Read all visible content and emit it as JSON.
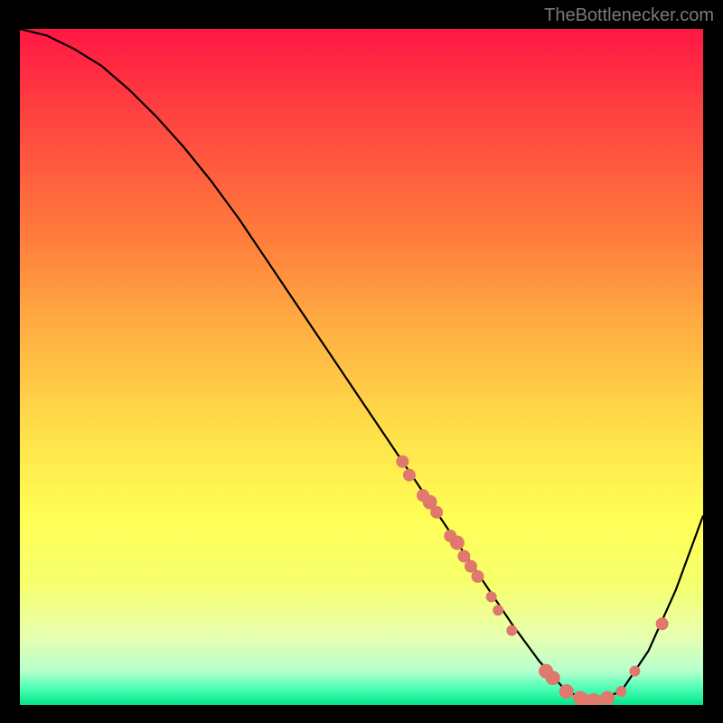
{
  "attribution": "TheBottlenecker.com",
  "chart_data": {
    "type": "line",
    "title": "",
    "xlabel": "",
    "ylabel": "",
    "xlim": [
      0,
      100
    ],
    "ylim": [
      0,
      100
    ],
    "series": [
      {
        "name": "bottleneck-curve",
        "x": [
          0,
          4,
          8,
          12,
          16,
          20,
          24,
          28,
          32,
          36,
          40,
          44,
          48,
          52,
          56,
          60,
          64,
          68,
          72,
          76,
          80,
          84,
          88,
          92,
          96,
          100
        ],
        "y": [
          100,
          99,
          97,
          94.5,
          91,
          87,
          82.5,
          77.5,
          72,
          66,
          60,
          54,
          48,
          42,
          36,
          30,
          24,
          18,
          12,
          6.5,
          2,
          0.5,
          2,
          8,
          17,
          28
        ],
        "stroke": "#000000"
      }
    ],
    "markers": [
      {
        "x": 56,
        "y": 36,
        "r": 7
      },
      {
        "x": 57,
        "y": 34,
        "r": 7
      },
      {
        "x": 59,
        "y": 31,
        "r": 7
      },
      {
        "x": 60,
        "y": 30,
        "r": 8
      },
      {
        "x": 61,
        "y": 28.5,
        "r": 7
      },
      {
        "x": 63,
        "y": 25,
        "r": 7
      },
      {
        "x": 64,
        "y": 24,
        "r": 8
      },
      {
        "x": 65,
        "y": 22,
        "r": 7
      },
      {
        "x": 66,
        "y": 20.5,
        "r": 7
      },
      {
        "x": 67,
        "y": 19,
        "r": 7
      },
      {
        "x": 69,
        "y": 16,
        "r": 6
      },
      {
        "x": 70,
        "y": 14,
        "r": 6
      },
      {
        "x": 72,
        "y": 11,
        "r": 6
      },
      {
        "x": 77,
        "y": 5,
        "r": 8
      },
      {
        "x": 78,
        "y": 4,
        "r": 8
      },
      {
        "x": 80,
        "y": 2,
        "r": 8
      },
      {
        "x": 82,
        "y": 1,
        "r": 8
      },
      {
        "x": 83,
        "y": 0.5,
        "r": 8
      },
      {
        "x": 84,
        "y": 0.5,
        "r": 9
      },
      {
        "x": 86,
        "y": 1,
        "r": 8
      },
      {
        "x": 88,
        "y": 2,
        "r": 6
      },
      {
        "x": 90,
        "y": 5,
        "r": 6
      },
      {
        "x": 94,
        "y": 12,
        "r": 7
      }
    ],
    "marker_fill": "#e0786d",
    "gradient_stops": [
      {
        "offset": 0.0,
        "color": "#ff1744"
      },
      {
        "offset": 0.12,
        "color": "#ff4040"
      },
      {
        "offset": 0.3,
        "color": "#ff7a3c"
      },
      {
        "offset": 0.45,
        "color": "#ffb143"
      },
      {
        "offset": 0.6,
        "color": "#ffe14a"
      },
      {
        "offset": 0.72,
        "color": "#ffff55"
      },
      {
        "offset": 0.82,
        "color": "#f6ff6c"
      },
      {
        "offset": 0.9,
        "color": "#e6ffb0"
      },
      {
        "offset": 0.95,
        "color": "#b6ffcd"
      },
      {
        "offset": 0.975,
        "color": "#4fffb6"
      },
      {
        "offset": 1.0,
        "color": "#00e58a"
      }
    ]
  }
}
